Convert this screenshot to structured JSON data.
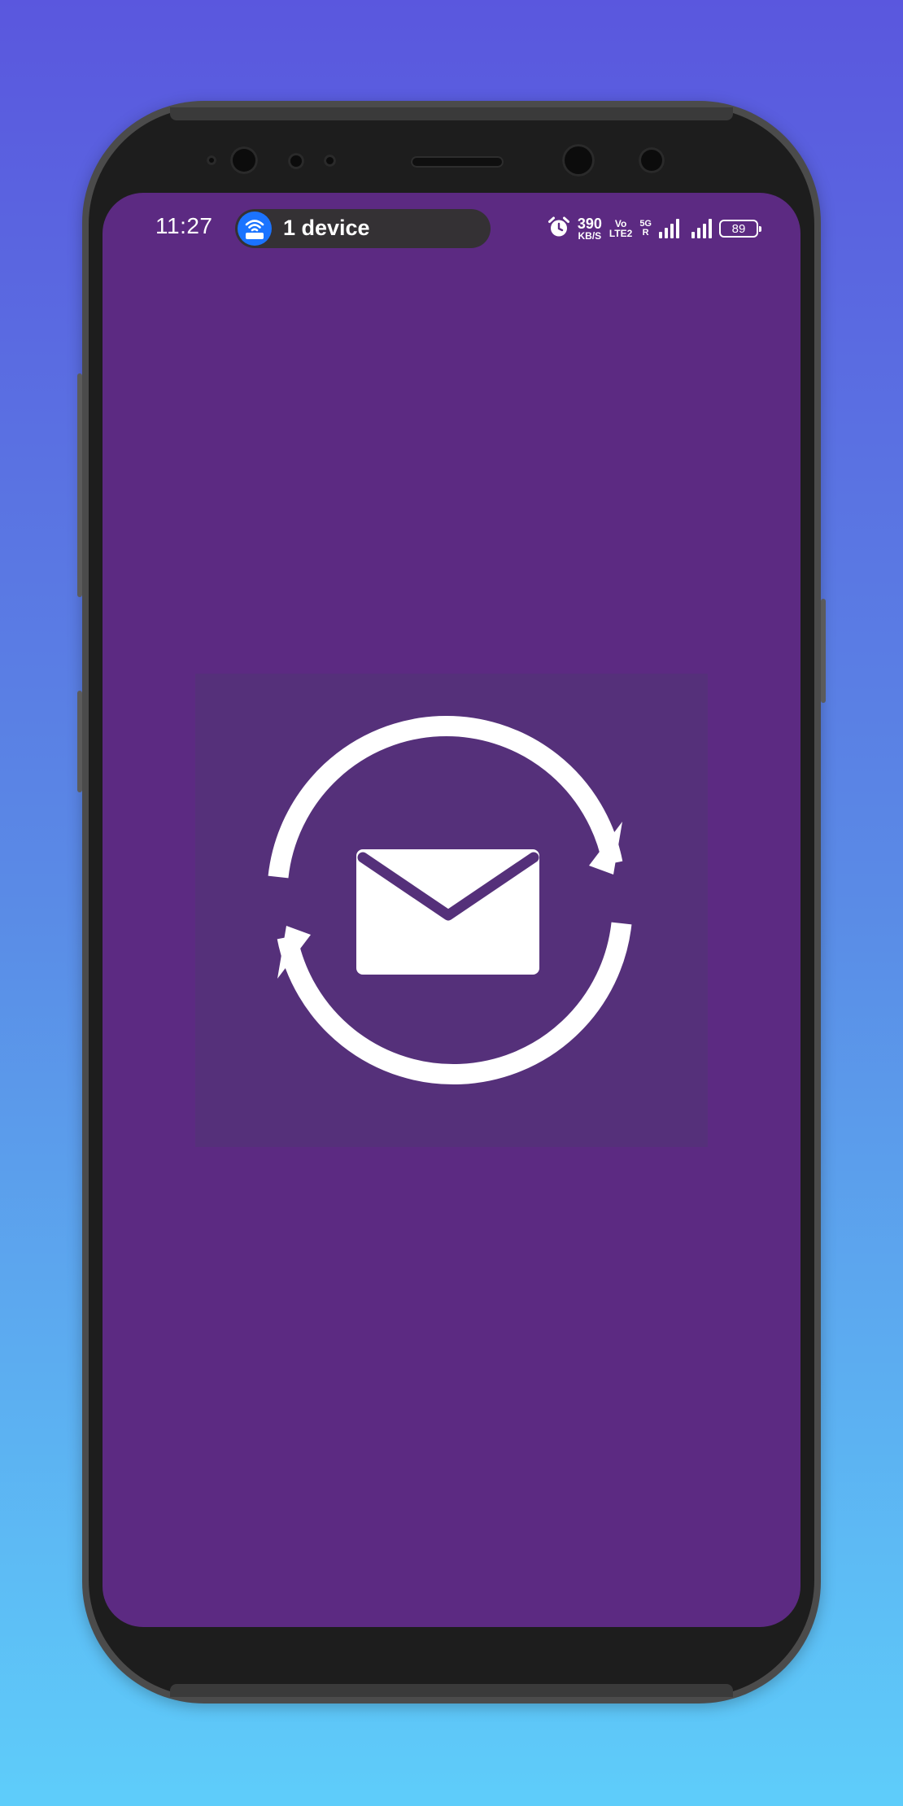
{
  "status_bar": {
    "time": "11:27",
    "hotspot": {
      "label": "1 device",
      "icon": "wifi-hotspot-icon",
      "color": "#1b73ff"
    },
    "alarm_icon": "alarm-clock-icon",
    "network_speed": {
      "value": "390",
      "unit": "KB/S"
    },
    "volte": {
      "top": "Vo",
      "bottom": "LTE2"
    },
    "network_type": {
      "top": "5G",
      "bottom": "R"
    },
    "signal_icons": [
      "signal-bars-icon",
      "signal-bars-icon"
    ],
    "battery": {
      "level": "89",
      "icon": "battery-icon"
    }
  },
  "screen": {
    "background_color": "#5c2a82",
    "logo": {
      "name": "mail-sync-icon",
      "background_color": "#55307a",
      "foreground_color": "#ffffff"
    }
  }
}
